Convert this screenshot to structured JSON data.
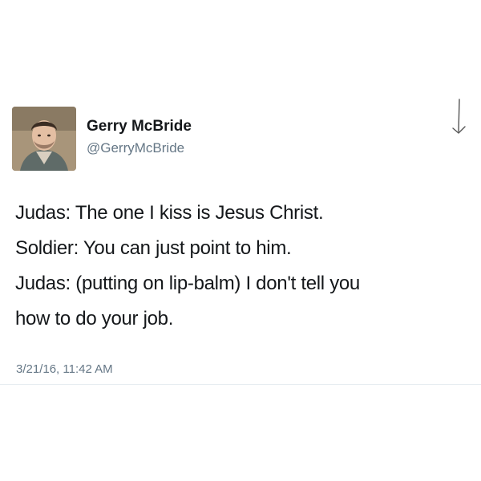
{
  "author": {
    "name": "Gerry McBride",
    "handle": "@GerryMcBride"
  },
  "tweet": {
    "lines": [
      "Judas: The one I kiss is Jesus Christ.",
      "Soldier: You can just point to him.",
      "Judas: (putting on lip-balm) I don't tell you",
      "how to do your job."
    ],
    "timestamp": "3/21/16, 11:42 AM"
  },
  "icons": {
    "avatar": "profile-photo",
    "menu": "chevron-down-icon"
  },
  "colors": {
    "text": "#14171a",
    "secondary": "#657786",
    "background": "#ffffff",
    "divider": "#e6ecf0"
  }
}
